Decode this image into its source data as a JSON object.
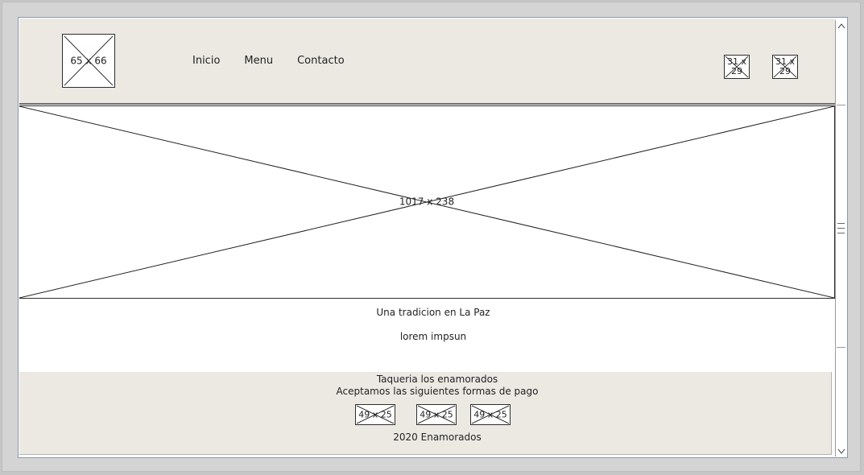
{
  "header": {
    "logo_dims": "65 x 66",
    "nav": [
      "Inicio",
      "Menu",
      "Contacto"
    ],
    "social_icon_1_dims": "31 x 29",
    "social_icon_2_dims": "31 x 29"
  },
  "hero": {
    "dims": "1017 x 238"
  },
  "content": {
    "tagline": "Una tradicion en La Paz",
    "lorem": "lorem impsun"
  },
  "footer": {
    "title": "Taqueria los enamorados",
    "payments_label": "Aceptamos las siguientes formas de pago",
    "payment_icons": [
      "49 x 25",
      "49 x 25",
      "49 x 25"
    ],
    "copyright": "2020 Enamorados"
  },
  "scrollbar": {
    "up_icon": "chevron-up-icon",
    "down_icon": "chevron-down-icon"
  },
  "colors": {
    "panel_bg": "#ece9e3",
    "frame_border": "#8c97ab",
    "outer_bg": "#c6c6c6"
  }
}
